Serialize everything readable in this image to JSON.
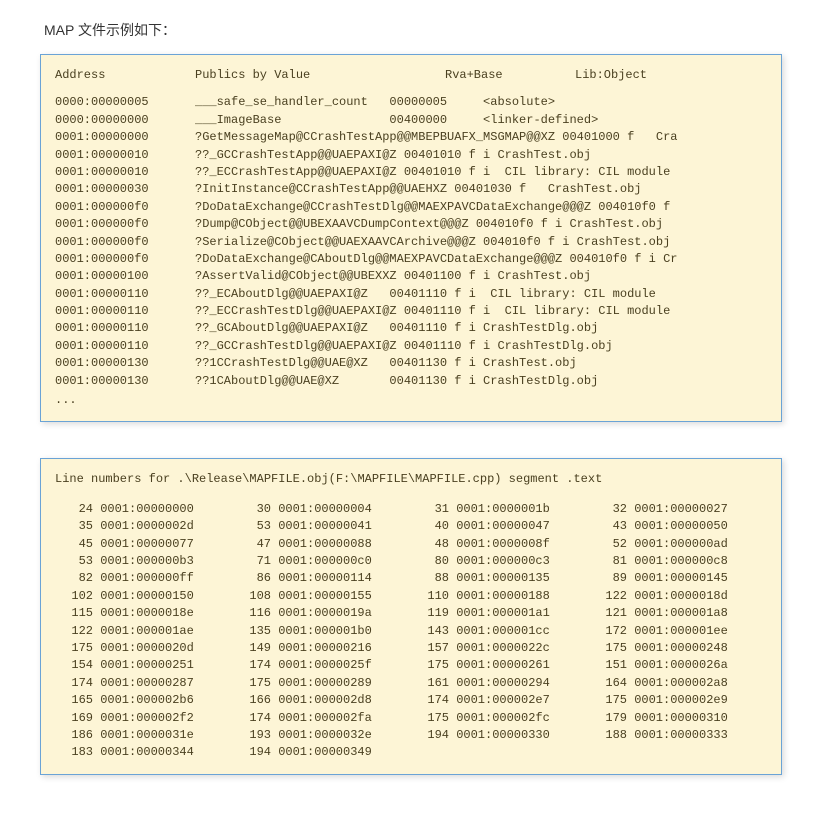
{
  "caption": "MAP 文件示例如下：",
  "map": {
    "headers": {
      "address": "Address",
      "publics": "Publics by Value",
      "rva": "Rva+Base",
      "lib": "Lib:Object"
    },
    "rows": [
      {
        "addr": "0000:00000005",
        "sym": "___safe_se_handler_count   00000005     <absolute>"
      },
      {
        "addr": "0000:00000000",
        "sym": "___ImageBase               00400000     <linker-defined>"
      },
      {
        "addr": "0001:00000000",
        "sym": "?GetMessageMap@CCrashTestApp@@MBEPBUAFX_MSGMAP@@XZ 00401000 f   Cra"
      },
      {
        "addr": "0001:00000010",
        "sym": "??_GCCrashTestApp@@UAEPAXI@Z 00401010 f i CrashTest.obj"
      },
      {
        "addr": "0001:00000010",
        "sym": "??_ECCrashTestApp@@UAEPAXI@Z 00401010 f i  CIL library: CIL module"
      },
      {
        "addr": "0001:00000030",
        "sym": "?InitInstance@CCrashTestApp@@UAEHXZ 00401030 f   CrashTest.obj"
      },
      {
        "addr": "0001:000000f0",
        "sym": "?DoDataExchange@CCrashTestDlg@@MAEXPAVCDataExchange@@@Z 004010f0 f"
      },
      {
        "addr": "0001:000000f0",
        "sym": "?Dump@CObject@@UBEXAAVCDumpContext@@@Z 004010f0 f i CrashTest.obj"
      },
      {
        "addr": "0001:000000f0",
        "sym": "?Serialize@CObject@@UAEXAAVCArchive@@@Z 004010f0 f i CrashTest.obj"
      },
      {
        "addr": "0001:000000f0",
        "sym": "?DoDataExchange@CAboutDlg@@MAEXPAVCDataExchange@@@Z 004010f0 f i Cr"
      },
      {
        "addr": "0001:00000100",
        "sym": "?AssertValid@CObject@@UBEXXZ 00401100 f i CrashTest.obj"
      },
      {
        "addr": "0001:00000110",
        "sym": "??_ECAboutDlg@@UAEPAXI@Z   00401110 f i  CIL library: CIL module"
      },
      {
        "addr": "0001:00000110",
        "sym": "??_ECCrashTestDlg@@UAEPAXI@Z 00401110 f i  CIL library: CIL module"
      },
      {
        "addr": "0001:00000110",
        "sym": "??_GCAboutDlg@@UAEPAXI@Z   00401110 f i CrashTestDlg.obj"
      },
      {
        "addr": "0001:00000110",
        "sym": "??_GCCrashTestDlg@@UAEPAXI@Z 00401110 f i CrashTestDlg.obj"
      },
      {
        "addr": "0001:00000130",
        "sym": "??1CCrashTestDlg@@UAE@XZ   00401130 f i CrashTest.obj"
      },
      {
        "addr": "0001:00000130",
        "sym": "??1CAboutDlg@@UAE@XZ       00401130 f i CrashTestDlg.obj"
      }
    ],
    "ellipsis": "..."
  },
  "lines": {
    "title": "Line numbers for .\\Release\\MAPFILE.obj(F:\\MAPFILE\\MAPFILE.cpp) segment .text",
    "entries": [
      {
        "ln": "24",
        "addr": "0001:00000000"
      },
      {
        "ln": "30",
        "addr": "0001:00000004"
      },
      {
        "ln": "31",
        "addr": "0001:0000001b"
      },
      {
        "ln": "32",
        "addr": "0001:00000027"
      },
      {
        "ln": "35",
        "addr": "0001:0000002d"
      },
      {
        "ln": "53",
        "addr": "0001:00000041"
      },
      {
        "ln": "40",
        "addr": "0001:00000047"
      },
      {
        "ln": "43",
        "addr": "0001:00000050"
      },
      {
        "ln": "45",
        "addr": "0001:00000077"
      },
      {
        "ln": "47",
        "addr": "0001:00000088"
      },
      {
        "ln": "48",
        "addr": "0001:0000008f"
      },
      {
        "ln": "52",
        "addr": "0001:000000ad"
      },
      {
        "ln": "53",
        "addr": "0001:000000b3"
      },
      {
        "ln": "71",
        "addr": "0001:000000c0"
      },
      {
        "ln": "80",
        "addr": "0001:000000c3"
      },
      {
        "ln": "81",
        "addr": "0001:000000c8"
      },
      {
        "ln": "82",
        "addr": "0001:000000ff"
      },
      {
        "ln": "86",
        "addr": "0001:00000114"
      },
      {
        "ln": "88",
        "addr": "0001:00000135"
      },
      {
        "ln": "89",
        "addr": "0001:00000145"
      },
      {
        "ln": "102",
        "addr": "0001:00000150"
      },
      {
        "ln": "108",
        "addr": "0001:00000155"
      },
      {
        "ln": "110",
        "addr": "0001:00000188"
      },
      {
        "ln": "122",
        "addr": "0001:0000018d"
      },
      {
        "ln": "115",
        "addr": "0001:0000018e"
      },
      {
        "ln": "116",
        "addr": "0001:0000019a"
      },
      {
        "ln": "119",
        "addr": "0001:000001a1"
      },
      {
        "ln": "121",
        "addr": "0001:000001a8"
      },
      {
        "ln": "122",
        "addr": "0001:000001ae"
      },
      {
        "ln": "135",
        "addr": "0001:000001b0"
      },
      {
        "ln": "143",
        "addr": "0001:000001cc"
      },
      {
        "ln": "172",
        "addr": "0001:000001ee"
      },
      {
        "ln": "175",
        "addr": "0001:0000020d"
      },
      {
        "ln": "149",
        "addr": "0001:00000216"
      },
      {
        "ln": "157",
        "addr": "0001:0000022c"
      },
      {
        "ln": "175",
        "addr": "0001:00000248"
      },
      {
        "ln": "154",
        "addr": "0001:00000251"
      },
      {
        "ln": "174",
        "addr": "0001:0000025f"
      },
      {
        "ln": "175",
        "addr": "0001:00000261"
      },
      {
        "ln": "151",
        "addr": "0001:0000026a"
      },
      {
        "ln": "174",
        "addr": "0001:00000287"
      },
      {
        "ln": "175",
        "addr": "0001:00000289"
      },
      {
        "ln": "161",
        "addr": "0001:00000294"
      },
      {
        "ln": "164",
        "addr": "0001:000002a8"
      },
      {
        "ln": "165",
        "addr": "0001:000002b6"
      },
      {
        "ln": "166",
        "addr": "0001:000002d8"
      },
      {
        "ln": "174",
        "addr": "0001:000002e7"
      },
      {
        "ln": "175",
        "addr": "0001:000002e9"
      },
      {
        "ln": "169",
        "addr": "0001:000002f2"
      },
      {
        "ln": "174",
        "addr": "0001:000002fa"
      },
      {
        "ln": "175",
        "addr": "0001:000002fc"
      },
      {
        "ln": "179",
        "addr": "0001:00000310"
      },
      {
        "ln": "186",
        "addr": "0001:0000031e"
      },
      {
        "ln": "193",
        "addr": "0001:0000032e"
      },
      {
        "ln": "194",
        "addr": "0001:00000330"
      },
      {
        "ln": "188",
        "addr": "0001:00000333"
      },
      {
        "ln": "183",
        "addr": "0001:00000344"
      },
      {
        "ln": "194",
        "addr": "0001:00000349"
      }
    ]
  }
}
